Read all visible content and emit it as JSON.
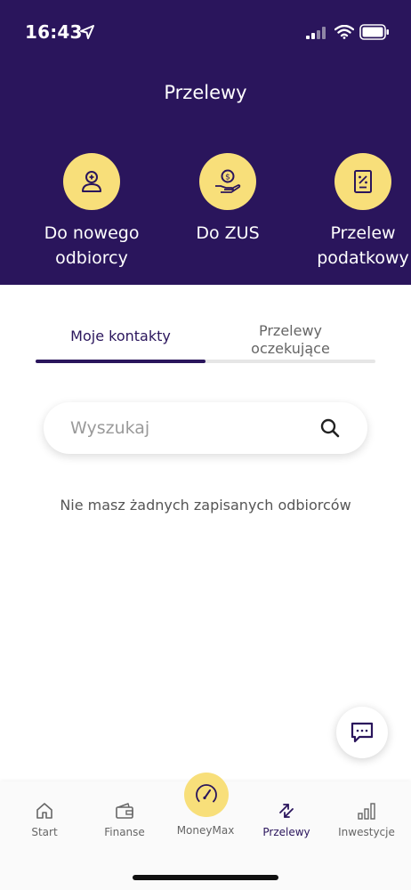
{
  "status_bar": {
    "time": "16:43"
  },
  "header": {
    "title": "Przelewy"
  },
  "quick_actions": [
    {
      "label": "Do nowego\nodbiorcy",
      "icon": "add-person-icon"
    },
    {
      "label": "Do ZUS",
      "icon": "coin-hand-icon"
    },
    {
      "label": "Przelew\npodatkowy",
      "icon": "tax-document-icon"
    }
  ],
  "tabs": [
    {
      "label": "Moje kontakty",
      "active": true
    },
    {
      "label": "Przelewy\noczekujące",
      "active": false
    }
  ],
  "search": {
    "placeholder": "Wyszukaj",
    "value": ""
  },
  "empty_state": {
    "message": "Nie masz żadnych zapisanych odbiorców"
  },
  "bottom_nav": [
    {
      "label": "Start",
      "icon": "home-icon",
      "active": false
    },
    {
      "label": "Finanse",
      "icon": "wallet-icon",
      "active": false
    },
    {
      "label": "MoneyMax",
      "icon": "gauge-icon",
      "active": false
    },
    {
      "label": "Przelewy",
      "icon": "transfer-arrows-icon",
      "active": true
    },
    {
      "label": "Inwestycje",
      "icon": "bar-chart-icon",
      "active": false
    }
  ],
  "colors": {
    "primary": "#2a155c",
    "accent": "#f8df7a",
    "background": "#ffffff"
  }
}
